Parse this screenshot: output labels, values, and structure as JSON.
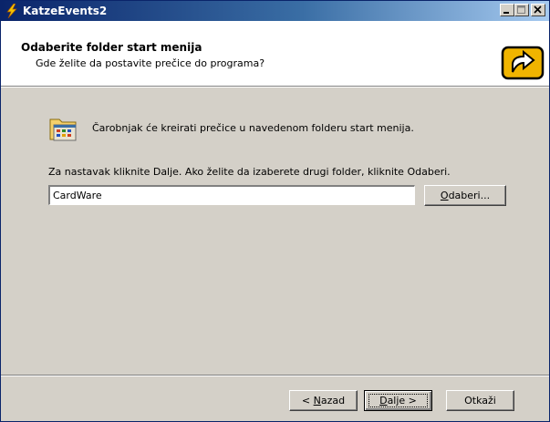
{
  "window": {
    "title": "KatzeEvents2"
  },
  "header": {
    "title": "Odaberite folder start menija",
    "subtitle": "Gde želite da postavite prečice do programa?"
  },
  "body": {
    "intro_text": "Čarobnjak će kreirati prečice u navedenom folderu start menija.",
    "instruction_text": "Za nastavak kliknite Dalje. Ako želite da izaberete drugi folder, kliknite Odaberi.",
    "folder_input_value": "CardWare",
    "browse_button": {
      "prefix": "",
      "mnemonic": "O",
      "rest": "daberi..."
    }
  },
  "footer": {
    "back_button": {
      "prefix": "< ",
      "mnemonic": "N",
      "rest": "azad"
    },
    "next_button": {
      "prefix": "",
      "mnemonic": "D",
      "rest": "alje >"
    },
    "cancel_button": "Otkaži"
  }
}
